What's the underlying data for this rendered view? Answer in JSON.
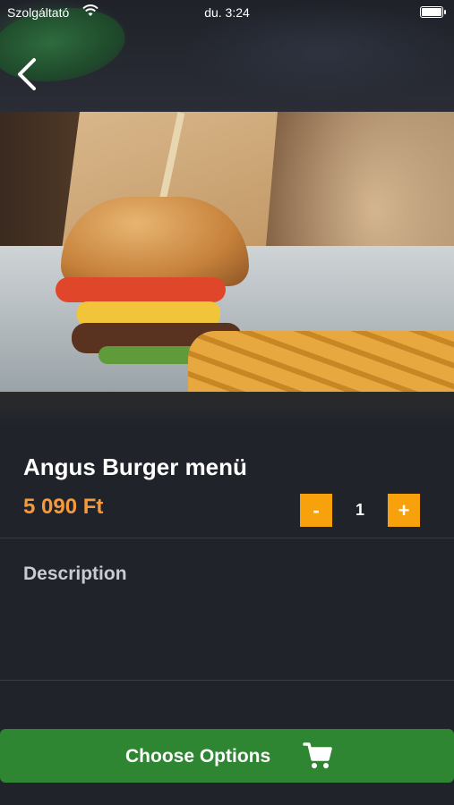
{
  "status_bar": {
    "carrier": "Szolgáltató",
    "time": "du. 3:24",
    "wifi_icon": "wifi-icon",
    "battery_icon": "battery-icon"
  },
  "nav": {
    "back_icon": "chevron-left-icon"
  },
  "product": {
    "name": "Angus Burger menü",
    "price": "5 090 Ft",
    "accent_color": "#f59a3b"
  },
  "quantity": {
    "minus_label": "-",
    "value": "1",
    "plus_label": "+",
    "button_color": "#f7a10d"
  },
  "description": {
    "label": "Description"
  },
  "cta": {
    "label": "Choose Options",
    "icon": "cart-icon",
    "color": "#2e8532"
  }
}
